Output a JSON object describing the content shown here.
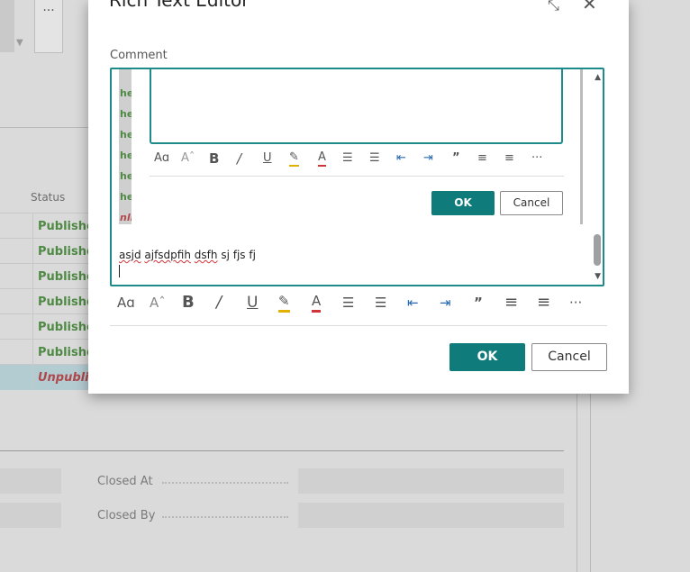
{
  "background": {
    "more_label": "...",
    "status_header": "Status",
    "status_rows": [
      {
        "label": "Publishe",
        "state": "published"
      },
      {
        "label": "Publishe",
        "state": "published"
      },
      {
        "label": "Publishe",
        "state": "published"
      },
      {
        "label": "Publishe",
        "state": "published"
      },
      {
        "label": "Publishe",
        "state": "published"
      },
      {
        "label": "Publishe",
        "state": "published"
      },
      {
        "label": "Unpublis",
        "state": "unpublished"
      }
    ],
    "closed_at_label": "Closed At",
    "closed_by_label": "Closed By"
  },
  "dialog": {
    "title": "Rich Text Editor",
    "comment_label": "Comment",
    "inner_strip": {
      "published_label": "he",
      "unpublished_label": "nli"
    },
    "inner_ok_label": "OK",
    "inner_cancel_label": "Cancel",
    "editor_text_words": [
      "asjd",
      "ajfsdpfih",
      "dsfh",
      "sj",
      "fjs",
      "fj"
    ],
    "ok_label": "OK",
    "cancel_label": "Cancel",
    "toolbar_glyphs": {
      "font_size": "Aɑ",
      "font_grow": "Aˆ",
      "bold": "B",
      "italic": "/",
      "underline": "U",
      "highlight": "✎",
      "font_color": "A",
      "bullets": "☰",
      "numbered": "☰",
      "outdent": "⇤",
      "indent": "⇥",
      "quote": "”",
      "align_left": "≡",
      "align_center": "≡",
      "more": "···"
    }
  },
  "colors": {
    "accent": "#0f7b7b",
    "published": "#4f8a44",
    "unpublished": "#b0484b",
    "spellcheck": "#d13438"
  }
}
